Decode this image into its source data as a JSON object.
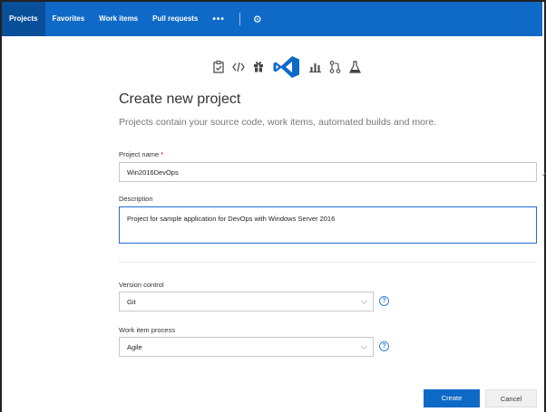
{
  "nav": {
    "items": [
      "Projects",
      "Favorites",
      "Work items",
      "Pull requests"
    ],
    "more": "•••",
    "settings_icon": "gear-icon"
  },
  "toolbar_icons": [
    "clipboard-check-icon",
    "code-icon",
    "gift-icon",
    "visual-studio-logo-icon",
    "chart-bars-icon",
    "pull-request-icon",
    "flask-icon"
  ],
  "form": {
    "title": "Create new project",
    "subtitle": "Projects contain your source code, work items, automated builds and more.",
    "project_name_label": "Project name",
    "required_marker": "*",
    "project_name_value": "Win2016DevOps",
    "description_label": "Description",
    "description_value": "Project for sample application for DevOps with Windows Server 2016",
    "version_control_label": "Version control",
    "version_control_value": "Git",
    "process_label": "Work item process",
    "process_value": "Agile",
    "create_label": "Create",
    "cancel_label": "Cancel"
  },
  "colors": {
    "accent": "#0f6ac7",
    "focus_border": "#1e6fd6",
    "valid": "#4a9a3d"
  }
}
